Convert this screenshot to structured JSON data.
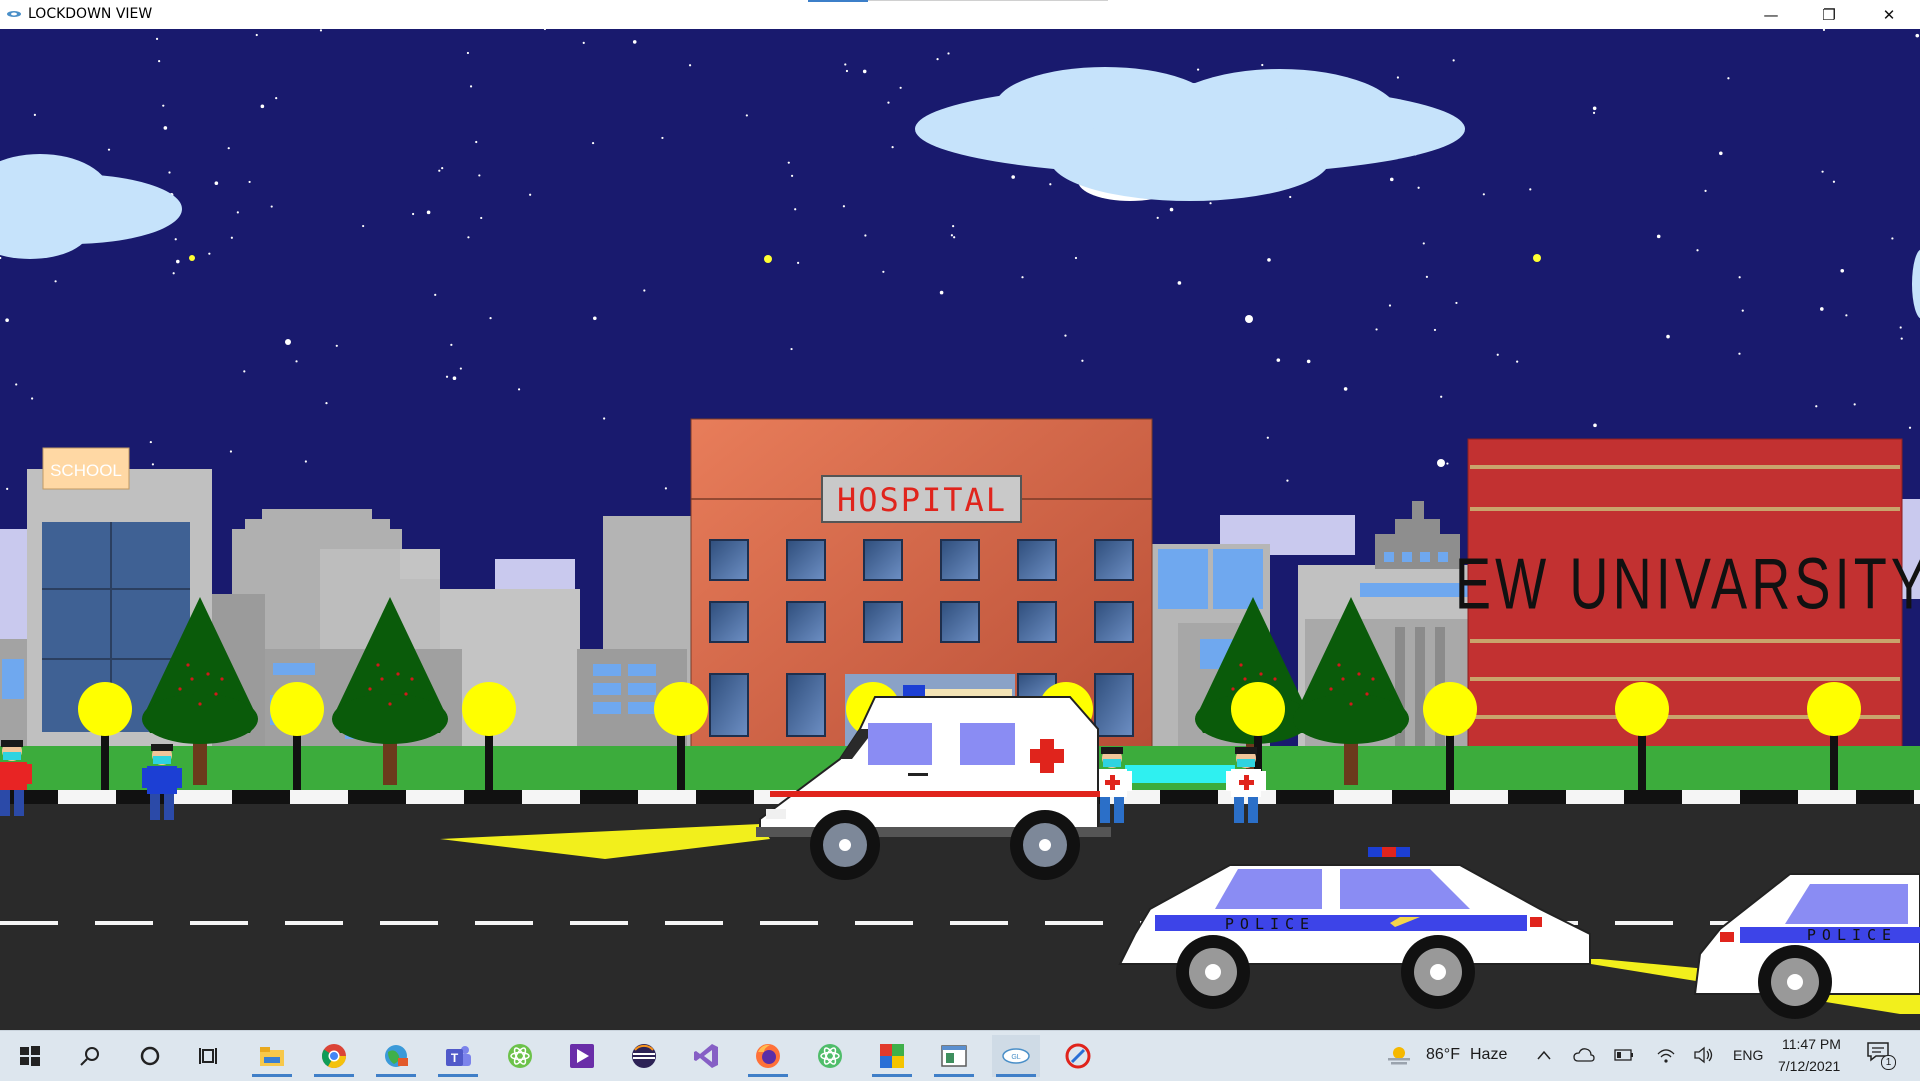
{
  "window": {
    "title": "LOCKDOWN VIEW",
    "minimize_glyph": "—",
    "maximize_glyph": "❐",
    "close_glyph": "✕"
  },
  "scene": {
    "buildings": {
      "school_sign": "SCHOOL",
      "hospital_sign": "HOSPITAL",
      "university_sign": "EW UNIVARSITY"
    },
    "vehicles": {
      "police_label": "POLICE"
    },
    "colors": {
      "sky": "#191a6e",
      "road": "#2a2a2a",
      "grass": "#3cac3c",
      "lamp": "#ffff00",
      "hospital": "#cc5b3f",
      "university": "#c13131"
    }
  },
  "taskbar": {
    "pinned": [
      {
        "name": "start-icon"
      },
      {
        "name": "search-icon"
      },
      {
        "name": "cortana-icon"
      },
      {
        "name": "task-view-icon"
      },
      {
        "name": "file-explorer-icon"
      },
      {
        "name": "chrome-icon"
      },
      {
        "name": "globe-app-icon"
      },
      {
        "name": "teams-icon"
      },
      {
        "name": "atom-icon"
      },
      {
        "name": "media-player-icon"
      },
      {
        "name": "eclipse-icon"
      },
      {
        "name": "visual-studio-icon"
      },
      {
        "name": "firefox-icon"
      },
      {
        "name": "atom-green-icon"
      },
      {
        "name": "colorful-app-icon"
      },
      {
        "name": "window-app-icon"
      },
      {
        "name": "opengl-app-icon"
      },
      {
        "name": "snip-tool-icon"
      }
    ],
    "weather": {
      "temp": "86°F",
      "condition": "Haze"
    },
    "language": "ENG",
    "time": "11:47 PM",
    "date": "7/12/2021",
    "notification_count": "1"
  }
}
